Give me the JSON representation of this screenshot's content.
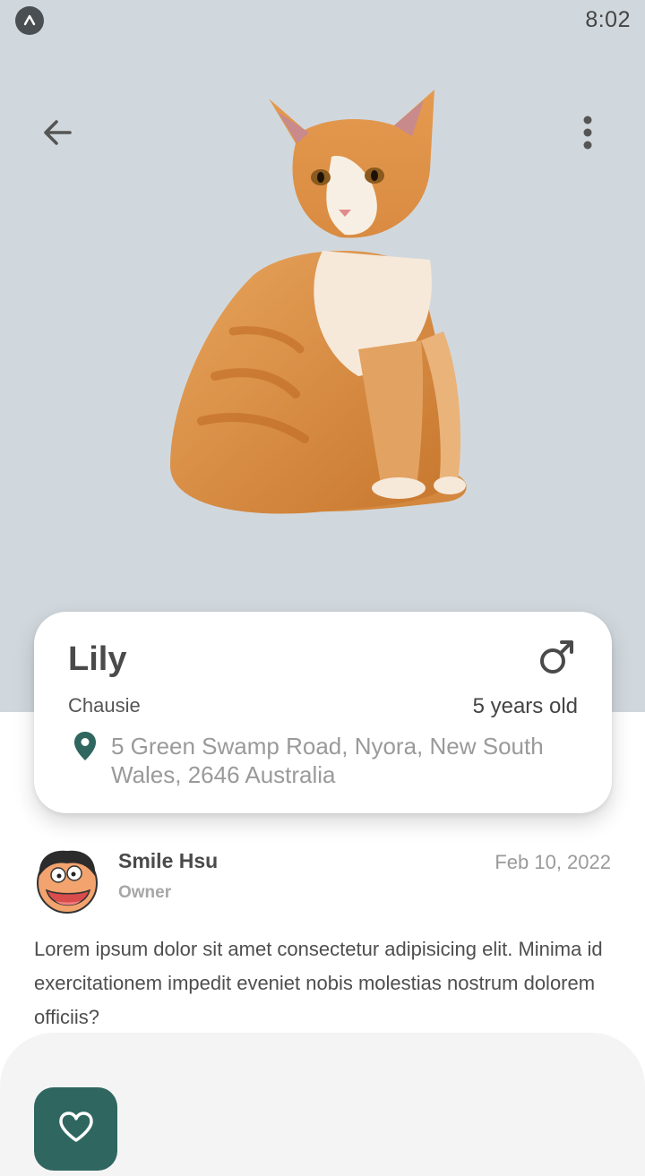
{
  "status_bar": {
    "time": "8:02",
    "app_icon": "app-logo-icon"
  },
  "header": {
    "back_icon": "arrow-left-icon",
    "more_icon": "more-vertical-icon",
    "background_color": "#d1d8dd"
  },
  "pet": {
    "image": "orange-cat-photo",
    "name": "Lily",
    "breed": "Chausie",
    "age": "5 years old",
    "gender_icon": "male-icon",
    "address": "5 Green Swamp Road, Nyora, New South Wales, 2646 Australia",
    "location_icon": "location-pin-icon"
  },
  "owner": {
    "name": "Smile Hsu",
    "role": "Owner",
    "date": "Feb 10, 2022",
    "avatar": "cartoon-avatar"
  },
  "description": "Lorem ipsum dolor sit amet consectetur adipisicing elit. Minima id exercitationem impedit eveniet nobis molestias nostrum dolorem officiis?",
  "actions": {
    "favorite_icon": "heart-icon",
    "accent_color": "#2f6660"
  }
}
